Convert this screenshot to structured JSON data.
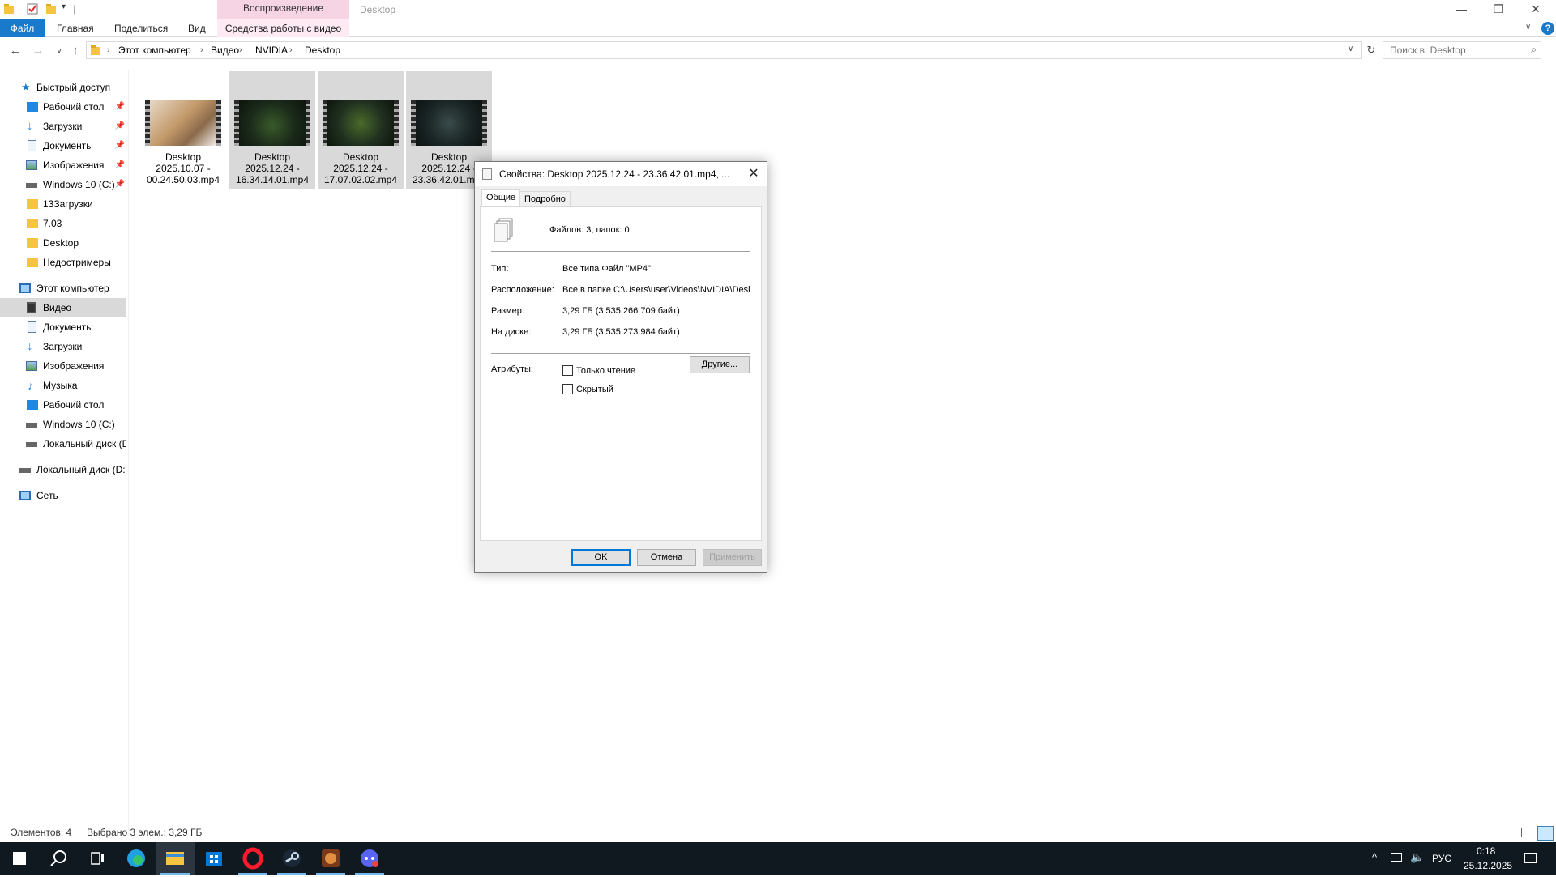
{
  "window": {
    "title": "Desktop",
    "context_tab_header": "Воспроизведение"
  },
  "ribbon": {
    "tabs": [
      "Файл",
      "Главная",
      "Поделиться",
      "Вид",
      "Средства работы с видео"
    ]
  },
  "address": {
    "crumbs": [
      "Этот компьютер",
      "Видео",
      "NVIDIA",
      "Desktop"
    ],
    "search_placeholder": "Поиск в: Desktop"
  },
  "sidebar": {
    "quick_access": {
      "label": "Быстрый доступ",
      "items": [
        {
          "label": "Рабочий стол",
          "icon": "desktop-icon",
          "pinned": true
        },
        {
          "label": "Загрузки",
          "icon": "download-icon",
          "pinned": true
        },
        {
          "label": "Документы",
          "icon": "document-icon",
          "pinned": true
        },
        {
          "label": "Изображения",
          "icon": "pictures-icon",
          "pinned": true
        },
        {
          "label": "Windows 10 (C:)",
          "icon": "drive-icon",
          "pinned": true
        },
        {
          "label": "13Загрузки",
          "icon": "folder-icon",
          "pinned": false
        },
        {
          "label": "7.03",
          "icon": "folder-icon",
          "pinned": false
        },
        {
          "label": "Desktop",
          "icon": "folder-icon",
          "pinned": false
        },
        {
          "label": "Недостримеры",
          "icon": "folder-icon",
          "pinned": false
        }
      ]
    },
    "this_pc": {
      "label": "Этот компьютер",
      "items": [
        {
          "label": "Видео",
          "icon": "video-icon",
          "selected": true
        },
        {
          "label": "Документы",
          "icon": "document-icon"
        },
        {
          "label": "Загрузки",
          "icon": "download-icon"
        },
        {
          "label": "Изображения",
          "icon": "pictures-icon"
        },
        {
          "label": "Музыка",
          "icon": "music-icon"
        },
        {
          "label": "Рабочий стол",
          "icon": "desktop-icon"
        },
        {
          "label": "Windows 10 (C:)",
          "icon": "drive-icon"
        },
        {
          "label": "Локальный диск (D:)",
          "icon": "drive-icon"
        }
      ]
    },
    "local_disk_d": {
      "label": "Локальный диск (D:)"
    },
    "network": {
      "label": "Сеть"
    }
  },
  "files": [
    {
      "name_lines": [
        "Desktop",
        "2025.10.07 -",
        "00.24.50.03.mp4"
      ],
      "selected": false
    },
    {
      "name_lines": [
        "Desktop",
        "2025.12.24 -",
        "16.34.14.01.mp4"
      ],
      "selected": true
    },
    {
      "name_lines": [
        "Desktop",
        "2025.12.24 -",
        "17.07.02.02.mp4"
      ],
      "selected": true
    },
    {
      "name_lines": [
        "Desktop",
        "2025.12.24 -",
        "23.36.42.01.mp4"
      ],
      "selected": true
    }
  ],
  "status": {
    "count": "Элементов: 4",
    "selection": "Выбрано 3 элем.: 3,29 ГБ"
  },
  "dialog": {
    "title": "Свойства: Desktop 2025.12.24 - 23.36.42.01.mp4, ...",
    "tabs": [
      "Общие",
      "Подробно"
    ],
    "summary": "Файлов: 3; папок: 0",
    "props": [
      {
        "label": "Тип:",
        "value": "Все типа Файл \"MP4\""
      },
      {
        "label": "Расположение:",
        "value": "Все в папке C:\\Users\\user\\Videos\\NVIDIA\\Desk"
      },
      {
        "label": "Размер:",
        "value": "3,29 ГБ (3 535 266 709 байт)"
      },
      {
        "label": "На диске:",
        "value": "3,29 ГБ (3 535 273 984 байт)"
      }
    ],
    "attributes_label": "Атрибуты:",
    "readonly_label": "Только чтение",
    "hidden_label": "Скрытый",
    "other_button": "Другие...",
    "ok_button": "OK",
    "cancel_button": "Отмена",
    "apply_button": "Применить"
  },
  "taskbar": {
    "language": "РУС",
    "time": "0:18",
    "date": "25.12.2025"
  }
}
